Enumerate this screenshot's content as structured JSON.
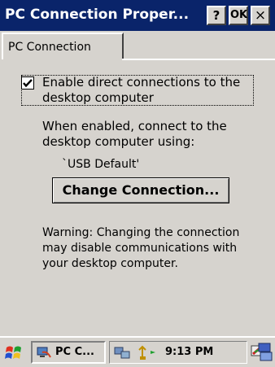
{
  "window": {
    "title": "PC Connection Proper...",
    "help_label": "?",
    "ok_label": "OK",
    "close_label": "×"
  },
  "tab": {
    "label": "PC Connection"
  },
  "settings": {
    "enable_label": "Enable direct connections to the desktop computer",
    "enable_checked": true,
    "when_text": "When enabled, connect to the desktop computer using:",
    "connection_value": "`USB Default'",
    "change_button": "Change Connection...",
    "warning": "Warning: Changing the connection may disable communications with your desktop computer."
  },
  "taskbar": {
    "task_label": "PC C...",
    "clock": "9:13 PM"
  },
  "colors": {
    "titlebar": "#0a246a",
    "face": "#d6d3ce"
  }
}
